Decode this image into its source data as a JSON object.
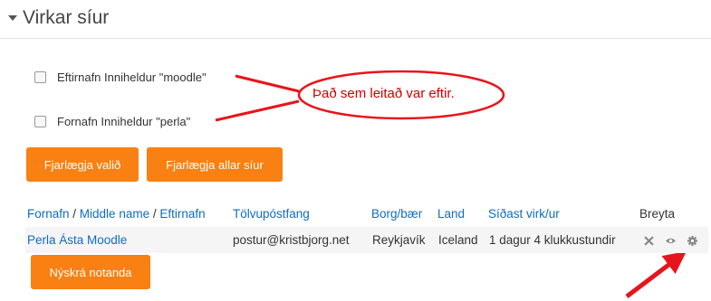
{
  "section": {
    "title": "Virkar síur"
  },
  "filters": [
    {
      "label": "Eftirnafn Inniheldur \"moodle\"",
      "checked": false
    },
    {
      "label": "Fornafn Inniheldur \"perla\"",
      "checked": false
    }
  ],
  "callout": {
    "text": "Það sem leitað var eftir."
  },
  "buttons": {
    "remove_selected": "Fjarlægja valið",
    "remove_all": "Fjarlægja allar síur",
    "add_user": "Nýskrá notanda"
  },
  "table": {
    "headers": {
      "firstname": "Fornafn",
      "sep1": " / ",
      "middlename": "Middle name",
      "sep2": " / ",
      "lastname": "Eftirnafn",
      "email": "Tölvupóstfang",
      "city": "Borg/bær",
      "country": "Land",
      "lastaccess": "Síðast virk/ur",
      "edit": "Breyta"
    },
    "rows": [
      {
        "name": "Perla Ásta Moodle",
        "email": "postur@kristbjorg.net",
        "city": "Reykjavík",
        "country": "Iceland",
        "lastaccess": "1 dagur 4 klukkustundir",
        "actions": [
          "delete-icon",
          "eye-icon",
          "gear-icon"
        ]
      }
    ]
  },
  "colors": {
    "accent": "#f98012",
    "link": "#0f6cbf",
    "annotation": "#e8141b"
  }
}
